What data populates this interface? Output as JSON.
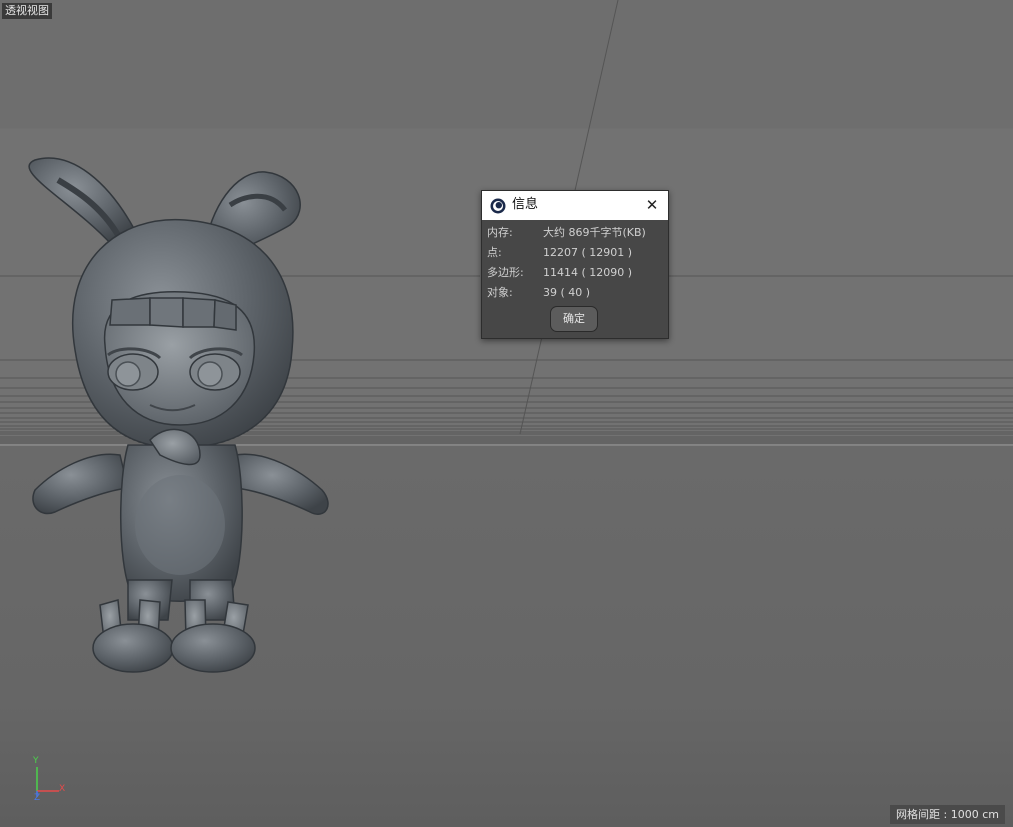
{
  "viewport": {
    "title": "透视视图",
    "grid_spacing": "网格间距 : 1000 cm",
    "axes": {
      "y": "Y",
      "x": "X",
      "z": "Z"
    }
  },
  "dialog": {
    "title": "信息",
    "close_icon": "close-icon",
    "rows": [
      {
        "label": "内存:",
        "value": "大约 869千字节(KB)"
      },
      {
        "label": "点:",
        "value": "12207 ( 12901 )"
      },
      {
        "label": "多边形:",
        "value": "11414 ( 12090 )"
      },
      {
        "label": "对象:",
        "value": "39 ( 40 )"
      }
    ],
    "ok_label": "确定"
  },
  "colors": {
    "model": "#5f656b",
    "dialog_bg": "#474747",
    "axis_x": "#e64a4a",
    "axis_y": "#4bd24b",
    "axis_z": "#4a78e6"
  }
}
